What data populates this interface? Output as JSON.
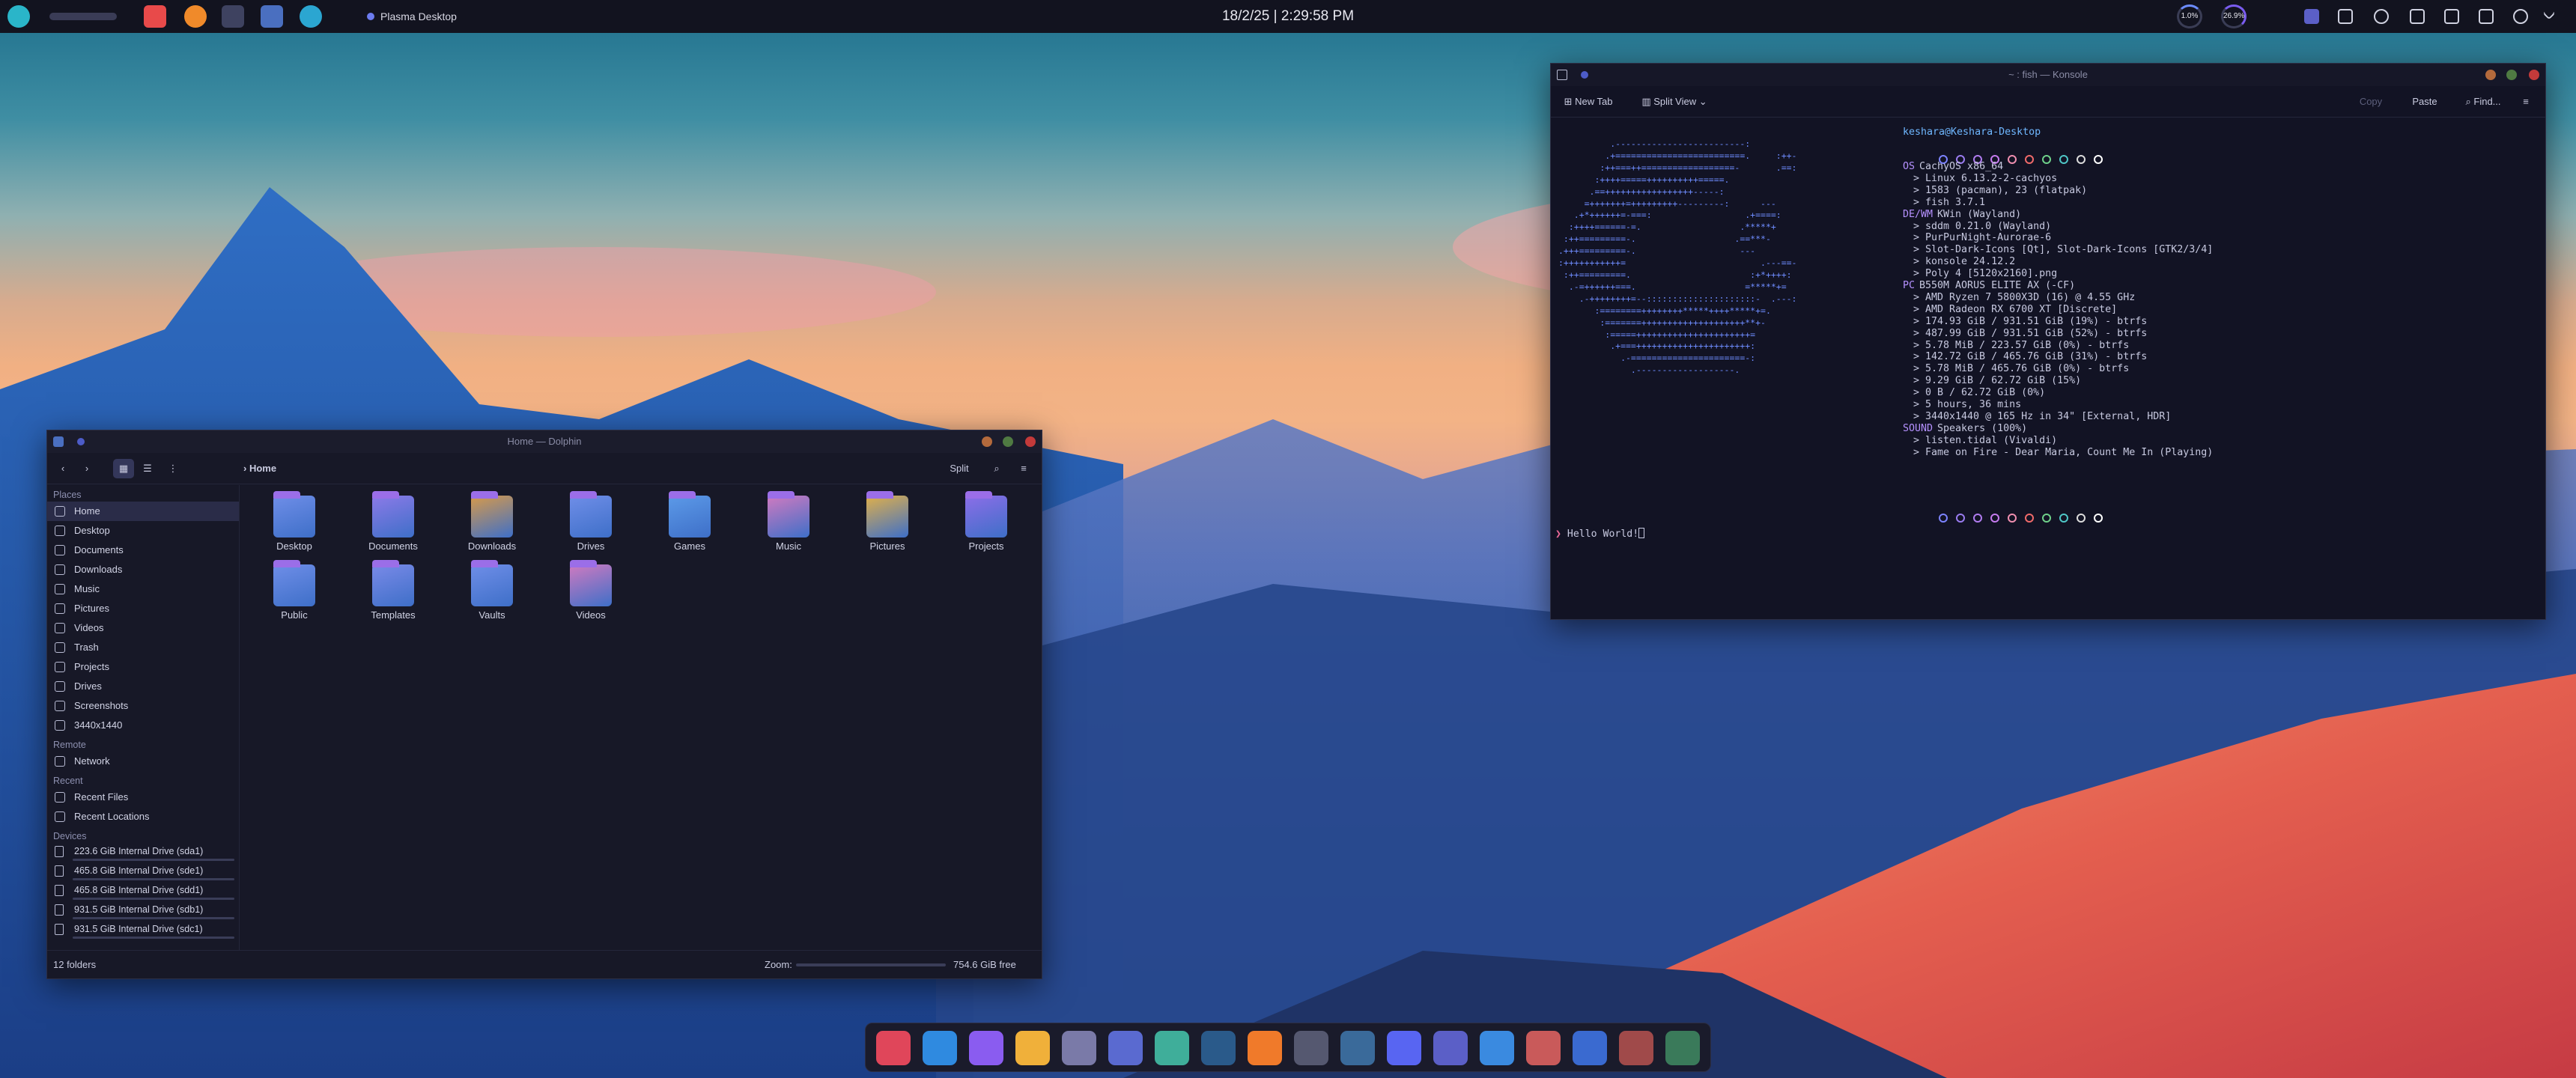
{
  "topbar": {
    "clock": "18/2/25 | 2:29:58 PM",
    "task_title": "Plasma Desktop",
    "cpu_gauge": "1.0%",
    "mem_gauge": "26.9%"
  },
  "dolphin": {
    "title": "Home — Dolphin",
    "breadcrumb": "Home",
    "split_label": "Split",
    "places_heading": "Places",
    "places": [
      "Home",
      "Desktop",
      "Documents",
      "Downloads",
      "Music",
      "Pictures",
      "Videos",
      "Trash",
      "Projects",
      "Drives",
      "Screenshots",
      "3440x1440"
    ],
    "remote_heading": "Remote",
    "remote": [
      "Network"
    ],
    "recent_heading": "Recent",
    "recent": [
      "Recent Files",
      "Recent Locations"
    ],
    "devices_heading": "Devices",
    "devices": [
      "223.6 GiB Internal Drive (sda1)",
      "465.8 GiB Internal Drive (sde1)",
      "465.8 GiB Internal Drive (sdd1)",
      "931.5 GiB Internal Drive (sdb1)",
      "931.5 GiB Internal Drive (sdc1)"
    ],
    "folders": [
      "Desktop",
      "Documents",
      "Downloads",
      "Drives",
      "Games",
      "Music",
      "Pictures",
      "Projects",
      "Public",
      "Templates",
      "Vaults",
      "Videos"
    ],
    "status_count": "12 folders",
    "zoom_label": "Zoom:",
    "free_space": "754.6 GiB free"
  },
  "konsole": {
    "title": "~ : fish — Konsole",
    "new_tab": "New Tab",
    "split_view": "Split View",
    "copy": "Copy",
    "paste": "Paste",
    "find": "Find...",
    "user_host": "keshara@Keshara-Desktop",
    "fetch_lines": [
      {
        "key": "OS",
        "text": "CachyOS x86_64"
      },
      {
        "key": "",
        "text": "> Linux 6.13.2-2-cachyos"
      },
      {
        "key": "",
        "text": "> 1583 (pacman), 23 (flatpak)"
      },
      {
        "key": "",
        "text": "> fish 3.7.1"
      },
      {
        "key": "DE/WM",
        "text": "KWin (Wayland)"
      },
      {
        "key": "",
        "text": "> sddm 0.21.0 (Wayland)"
      },
      {
        "key": "",
        "text": "> PurPurNight-Aurorae-6"
      },
      {
        "key": "",
        "text": "> Slot-Dark-Icons [Qt], Slot-Dark-Icons [GTK2/3/4]"
      },
      {
        "key": "",
        "text": "> konsole 24.12.2"
      },
      {
        "key": "",
        "text": "> Poly 4 [5120x2160].png"
      },
      {
        "key": "PC",
        "text": "B550M AORUS ELITE AX (-CF)"
      },
      {
        "key": "",
        "text": "> AMD Ryzen 7 5800X3D (16) @ 4.55 GHz"
      },
      {
        "key": "",
        "text": "> AMD Radeon RX 6700 XT [Discrete]"
      },
      {
        "key": "",
        "text": "> 174.93 GiB / 931.51 GiB (19%) - btrfs"
      },
      {
        "key": "",
        "text": "> 487.99 GiB / 931.51 GiB (52%) - btrfs"
      },
      {
        "key": "",
        "text": "> 5.78 MiB / 223.57 GiB (0%) - btrfs"
      },
      {
        "key": "",
        "text": "> 142.72 GiB / 465.76 GiB (31%) - btrfs"
      },
      {
        "key": "",
        "text": "> 5.78 MiB / 465.76 GiB (0%) - btrfs"
      },
      {
        "key": "",
        "text": "> 9.29 GiB / 62.72 GiB (15%)"
      },
      {
        "key": "",
        "text": "> 0 B / 62.72 GiB (0%)"
      },
      {
        "key": "",
        "text": "> 5 hours, 36 mins"
      },
      {
        "key": "",
        "text": "> 3440x1440 @ 165 Hz in 34\" [External, HDR]"
      },
      {
        "key": "SOUND",
        "text": "Speakers (100%)"
      },
      {
        "key": "",
        "text": "> listen.tidal (Vivaldi)"
      },
      {
        "key": "",
        "text": "> Fame on Fire - Dear Maria, Count Me In (Playing)"
      }
    ],
    "prompt_line": "Hello World!"
  },
  "dock": {
    "apps": [
      "obs-icon",
      "vscode-icon",
      "obsidian-icon",
      "layers-icon",
      "game-icon",
      "dev-icon",
      "emulator-icon",
      "steam-icon",
      "firefox-icon",
      "dosbox-icon",
      "mountain-icon",
      "discord-icon",
      "teams-icon",
      "zoom-icon",
      "waves-icon",
      "download-icon",
      "ram-icon",
      "monitor-icon"
    ]
  }
}
